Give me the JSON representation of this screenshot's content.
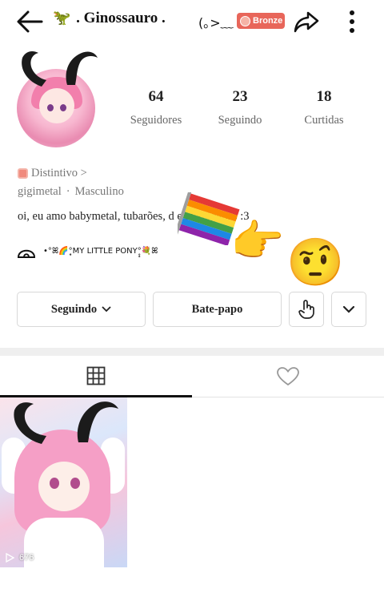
{
  "header": {
    "back_icon": "arrow-left-icon",
    "dino": "🦖",
    "title": ". Ginossauro .",
    "kaomoji": "(｡>﹏",
    "badge_label": "Bronze",
    "share_icon": "share-icon",
    "more_icon": "more-vertical-icon"
  },
  "profile": {
    "stats": [
      {
        "value": "64",
        "label": "Seguidores"
      },
      {
        "value": "23",
        "label": "Seguindo"
      },
      {
        "value": "18",
        "label": "Curtidas"
      }
    ],
    "distintivo": "Distintivo >",
    "username": "gigimetal",
    "gender": "Masculino",
    "bio": "oi, eu amo babymetal, tubarões, d                       e alienígenas :3",
    "extra": "•°ꕤ🌈°̥̥MY LITTLE PONY°̥̥💐ꕤ"
  },
  "buttons": {
    "follow": "Seguindo",
    "chat": "Bate-papo",
    "hand_icon": "tap-hand-icon",
    "dropdown_icon": "chevron-down-icon"
  },
  "tabs": {
    "grid_icon": "grid-icon",
    "likes_icon": "heart-icon"
  },
  "posts": [
    {
      "views": "676"
    }
  ],
  "colors": {
    "badge": "#e8665a",
    "tab_active": "#111111"
  }
}
